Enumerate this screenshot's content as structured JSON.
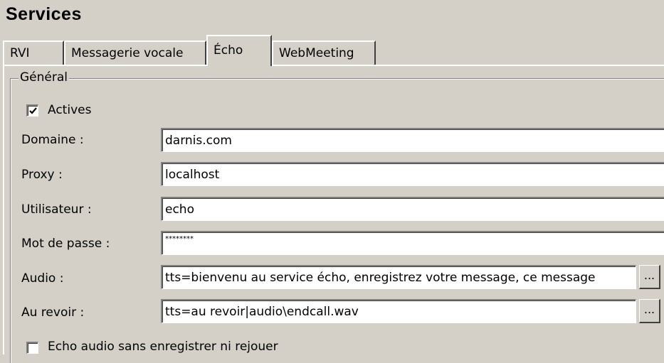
{
  "title": "Services",
  "tabs": [
    {
      "label": "RVI",
      "active": false
    },
    {
      "label": "Messagerie vocale",
      "active": false
    },
    {
      "label": "Écho",
      "active": true
    },
    {
      "label": "WebMeeting",
      "active": false
    }
  ],
  "group": {
    "label": "Général"
  },
  "actives": {
    "label": "Actives",
    "checked": true
  },
  "fields": {
    "domaine": {
      "label": "Domaine :",
      "value": "darnis.com"
    },
    "proxy": {
      "label": "Proxy :",
      "value": "localhost"
    },
    "utilisateur": {
      "label": "Utilisateur :",
      "value": "echo"
    },
    "mot_de_passe": {
      "label": "Mot de passe :",
      "value": "********"
    },
    "audio": {
      "label": "Audio :",
      "value": "tts=bienvenu au service écho, enregistrez votre message, ce message"
    },
    "au_revoir": {
      "label": "Au revoir :",
      "value": "tts=au revoir|audio\\endcall.wav"
    }
  },
  "browse_label": "...",
  "echo_option": {
    "label": "Echo audio sans enregistrer ni rejouer",
    "checked": false
  }
}
